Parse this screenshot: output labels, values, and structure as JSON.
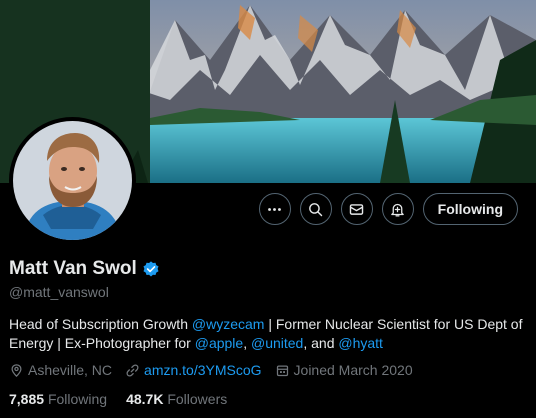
{
  "banner": {
    "icon": "mountain-lake-photo"
  },
  "avatar": {
    "icon": "profile-photo"
  },
  "actions": {
    "more_icon": "more-icon",
    "search_icon": "search-icon",
    "message_icon": "mail-icon",
    "notify_icon": "bell-plus-icon",
    "following_label": "Following"
  },
  "profile": {
    "name": "Matt Van Swol",
    "handle": "@matt_vanswol",
    "verified_icon": "verified-badge-icon"
  },
  "bio": {
    "line1_prefix": "Head of Subscription Growth ",
    "link_wyzecam": "@wyzecam",
    "line1_suffix": " | Former Nuclear Scientist for US Dept of",
    "line2_prefix": "Energy | Ex-Photographer for ",
    "link_apple": "@apple",
    "sep1": ", ",
    "link_united": "@united",
    "sep2": ", and ",
    "link_hyatt": "@hyatt"
  },
  "meta": {
    "location": "Asheville, NC",
    "website": "amzn.to/3YMScoG",
    "joined": "Joined March 2020"
  },
  "stats": {
    "following_count": "7,885",
    "following_label": "Following",
    "followers_count": "48.7K",
    "followers_label": "Followers"
  },
  "colors": {
    "background": "#000000",
    "accent": "#1d9bf0",
    "muted": "#71767b",
    "text": "#e7e9ea"
  }
}
